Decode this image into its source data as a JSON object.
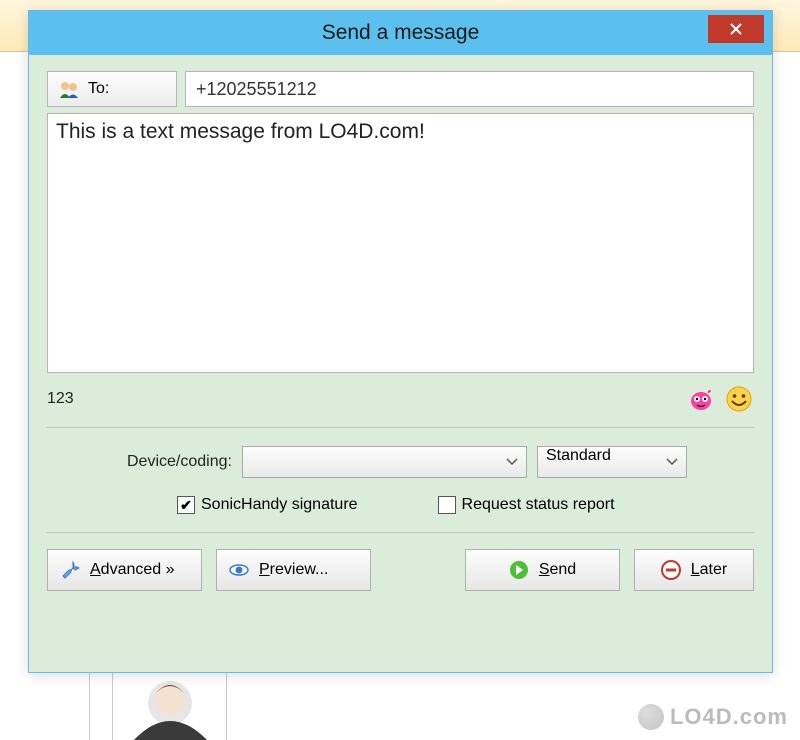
{
  "dialog": {
    "title": "Send a message",
    "to_button": "To:",
    "to_value": "+12025551212",
    "message_text": "This is a text message from LO4D.com!",
    "char_count": "123",
    "device_label": "Device/coding:",
    "device_value": "",
    "standard_value": "Standard",
    "check_signature_label": "SonicHandy signature",
    "check_signature_checked": true,
    "check_report_label": "Request status report",
    "check_report_checked": false,
    "buttons": {
      "advanced": "Advanced »",
      "preview": "Preview...",
      "send": "Send",
      "later": "Later"
    },
    "hotkeys": {
      "advanced_u": "A",
      "preview_u": "P",
      "send_u": "S",
      "later_u": "L"
    }
  },
  "watermark": "LO4D.com"
}
